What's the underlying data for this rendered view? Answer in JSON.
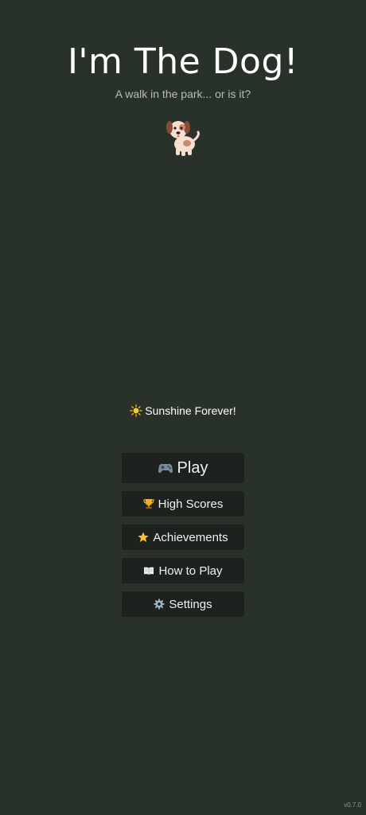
{
  "header": {
    "title": "I'm The Dog!",
    "subtitle": "A walk in the park... or is it?",
    "mascot_icon": "dog-icon"
  },
  "status": {
    "weather_icon": "sun-icon",
    "weather_text": "Sunshine Forever!"
  },
  "menu": {
    "play": {
      "icon": "gamepad-icon",
      "label": "Play"
    },
    "high_scores": {
      "icon": "trophy-icon",
      "label": "High Scores"
    },
    "achievements": {
      "icon": "star-icon",
      "label": "Achievements"
    },
    "how_to_play": {
      "icon": "book-icon",
      "label": "How to Play"
    },
    "settings": {
      "icon": "gear-icon",
      "label": "Settings"
    }
  },
  "footer": {
    "version": "v0.7.0"
  },
  "colors": {
    "background": "#29312b",
    "button_bg": "#1d221f",
    "subtitle": "#b7bdb8"
  }
}
